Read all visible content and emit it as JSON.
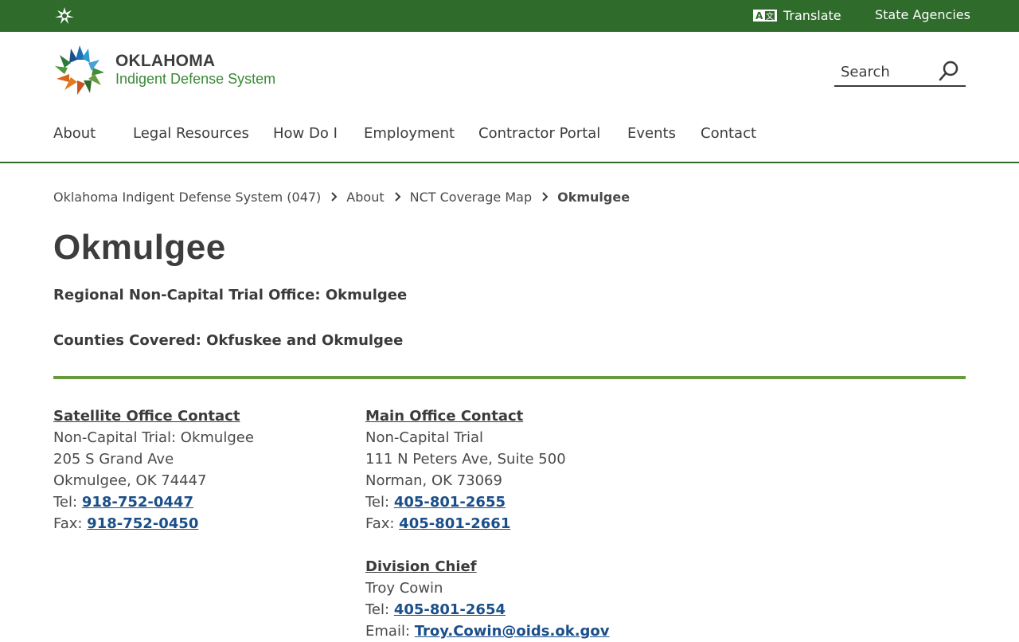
{
  "topbar": {
    "home_icon": "oklahoma-star-icon",
    "translate_icon": "translate-icon",
    "translate_label": "Translate",
    "agencies_label": "State Agencies"
  },
  "logo": {
    "line1": "OKLAHOMA",
    "line2": "Indigent Defense System"
  },
  "search": {
    "placeholder": "Search",
    "icon": "search-icon"
  },
  "nav": {
    "items": [
      {
        "label": "About"
      },
      {
        "label": "Legal Resources"
      },
      {
        "label": "How Do I"
      },
      {
        "label": "Employment"
      },
      {
        "label": "Contractor Portal"
      },
      {
        "label": "Events"
      },
      {
        "label": "Contact"
      }
    ]
  },
  "breadcrumb": {
    "items": [
      {
        "label": "Oklahoma Indigent Defense System (047)"
      },
      {
        "label": "About"
      },
      {
        "label": "NCT Coverage Map"
      }
    ],
    "current": "Okmulgee"
  },
  "page": {
    "title": "Okmulgee",
    "office_line": "Regional Non-Capital Trial Office: Okmulgee",
    "counties_line": "Counties Covered: Okfuskee and Okmulgee"
  },
  "satellite": {
    "heading": "Satellite Office Contact",
    "name": "Non-Capital Trial: Okmulgee",
    "street": "205 S Grand Ave",
    "city": "Okmulgee, OK 74447",
    "tel_label": "Tel: ",
    "tel": "918-752-0447",
    "fax_label": "Fax: ",
    "fax": "918-752-0450"
  },
  "main_office": {
    "heading": "Main Office Contact",
    "name": "Non-Capital Trial",
    "street": "111 N Peters Ave, Suite 500",
    "city": "Norman, OK 73069",
    "tel_label": "Tel: ",
    "tel": "405-801-2655",
    "fax_label": "Fax: ",
    "fax": "405-801-2661"
  },
  "division_chief": {
    "heading": "Division Chief",
    "name": "Troy Cowin",
    "tel_label": "Tel: ",
    "tel": "405-801-2654",
    "email_label": "Email: ",
    "email": "Troy.Cowin@oids.ok.gov"
  },
  "colors": {
    "topbar_green": "#2f6b2b",
    "rule_green": "#6a9a3f",
    "link_blue": "#1a4f8a"
  }
}
